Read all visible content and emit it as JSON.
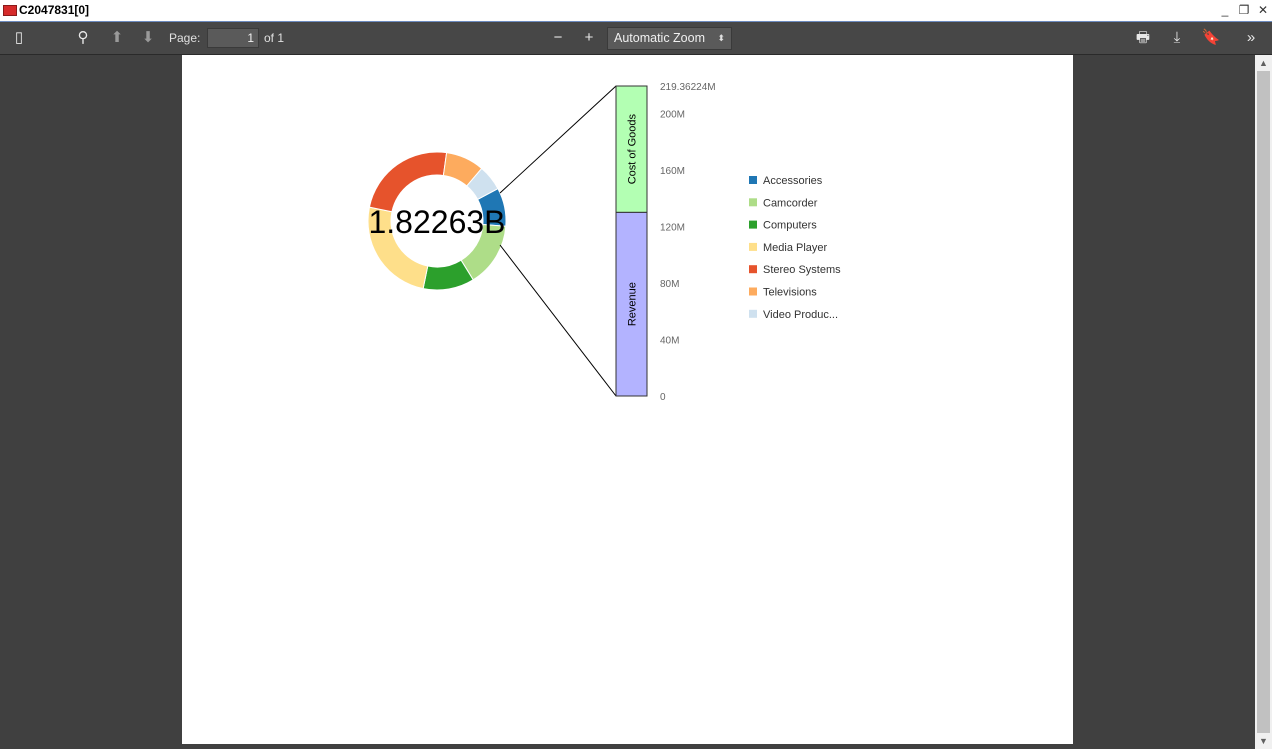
{
  "window": {
    "title": "C2047831[0]",
    "minimize": "_",
    "restore": "❐",
    "close": "✕"
  },
  "toolbar": {
    "sidebar_icon": "▯",
    "search_icon": "⚲",
    "prev_icon": "⬆",
    "next_icon": "⬇",
    "page_label": "Page:",
    "page_value": "1",
    "page_of": "of 1",
    "zoom_out": "−",
    "zoom_in": "+",
    "zoom_value": "Automatic Zoom",
    "zoom_caret": "⬍",
    "print_icon": "🖶",
    "download_icon": "⤓",
    "bookmark_icon": "🔖",
    "tools_icon": "»"
  },
  "chart_data": [
    {
      "type": "pie",
      "center_label": "1.82263B",
      "categories": [
        "Accessories",
        "Camcorder",
        "Computers",
        "Media Player",
        "Stereo Systems",
        "Televisions",
        "Video Produc..."
      ],
      "values": [
        0.09,
        0.15,
        0.12,
        0.25,
        0.24,
        0.09,
        0.06
      ],
      "colors": [
        "#1f77b4",
        "#aedd88",
        "#2ca02c",
        "#fedf8a",
        "#e6532c",
        "#fdab5e",
        "#cfe1ef"
      ],
      "legend_position": "right"
    },
    {
      "type": "bar",
      "stacked": true,
      "categories": [
        "Revenue",
        "Cost of Goods"
      ],
      "values": [
        130,
        89.36224
      ],
      "colors": [
        "#b3b3ff",
        "#b3ffb3"
      ],
      "ylim": [
        0,
        219.36224
      ],
      "yticks": [
        "0",
        "40M",
        "80M",
        "120M",
        "160M",
        "200M",
        "219.36224M"
      ],
      "ytick_values": [
        0,
        40,
        80,
        120,
        160,
        200,
        219.36224
      ]
    }
  ]
}
